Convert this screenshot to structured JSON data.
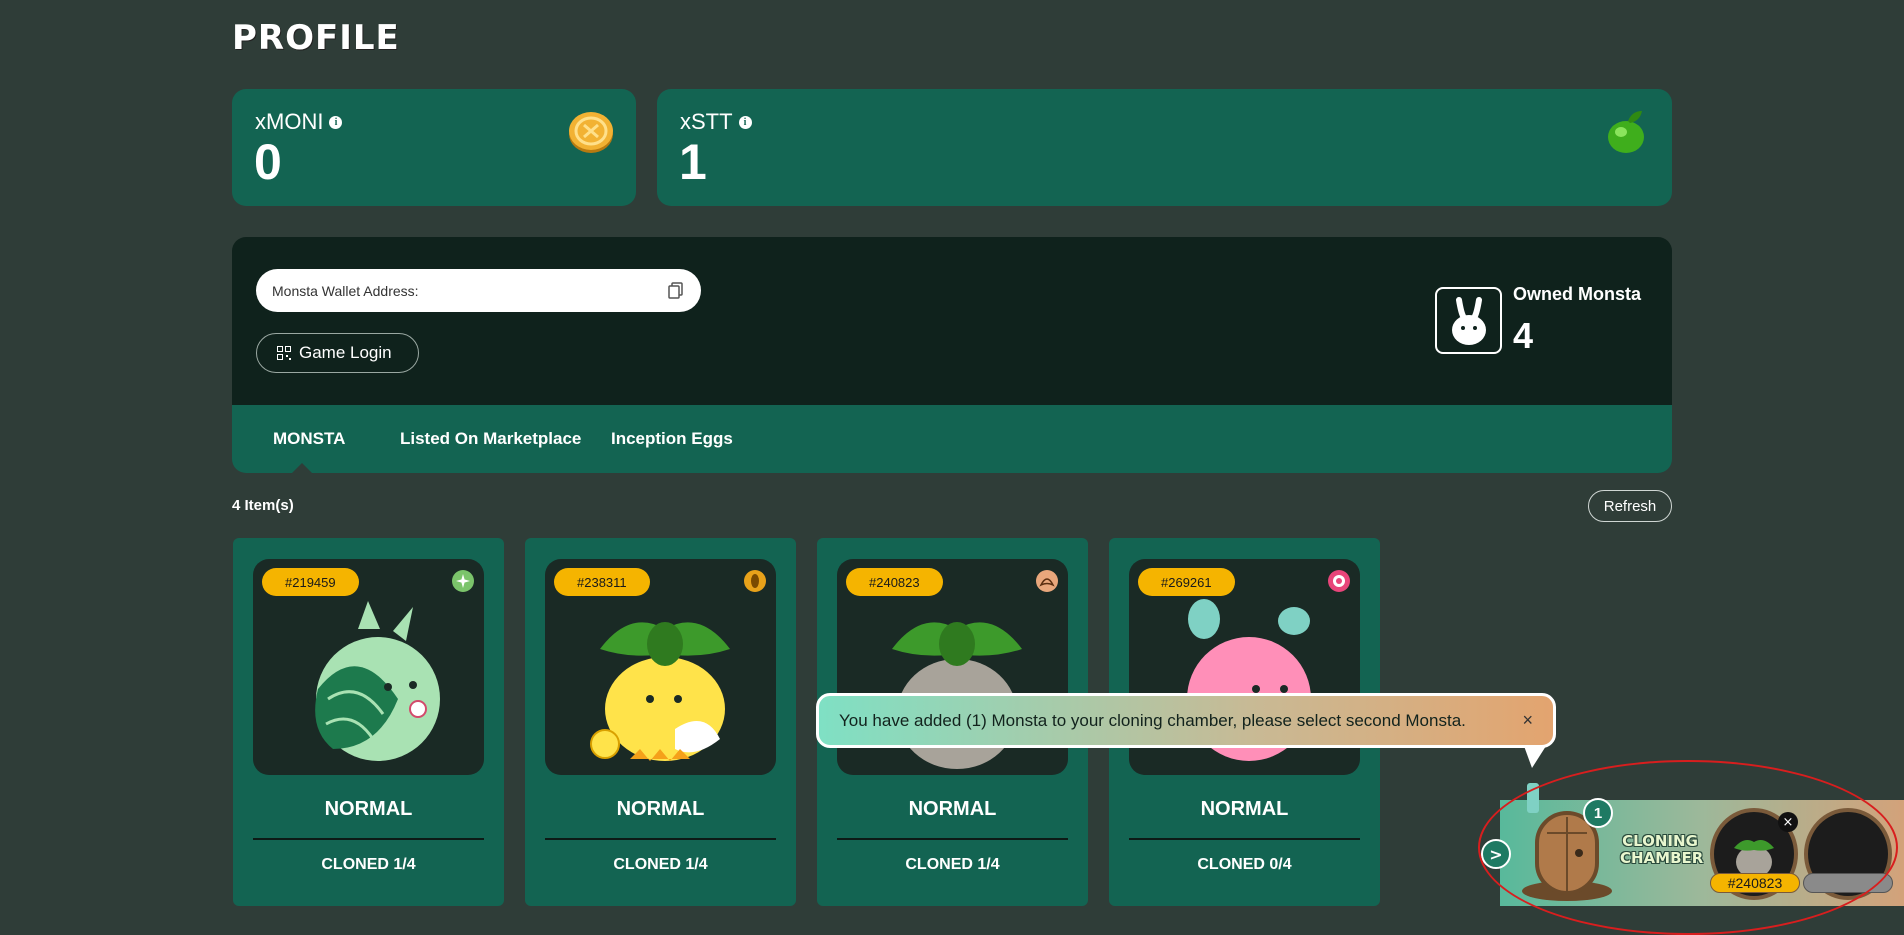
{
  "page": {
    "title": "PROFILE"
  },
  "balances": {
    "moni": {
      "label": "xMONI",
      "value": "0",
      "icon": "coin-icon"
    },
    "stt": {
      "label": "xSTT",
      "value": "1",
      "icon": "green-fruit-icon"
    }
  },
  "wallet": {
    "address_label": "Monsta Wallet Address:",
    "game_login_label": "Game Login",
    "owned_label": "Owned Monsta",
    "owned_count": "4"
  },
  "tabs": [
    {
      "label": "MONSTA",
      "active": true
    },
    {
      "label": "Listed On Marketplace",
      "active": false
    },
    {
      "label": "Inception Eggs",
      "active": false
    }
  ],
  "list": {
    "count_label": "4 Item(s)",
    "refresh_label": "Refresh"
  },
  "cards": [
    {
      "id": "#219459",
      "rarity": "NORMAL",
      "cloned": "CLONED 1/4",
      "class_color": "#7bc46b",
      "body_color": "#a9e2b3"
    },
    {
      "id": "#238311",
      "rarity": "NORMAL",
      "cloned": "CLONED 1/4",
      "class_color": "#e8a21a",
      "body_color": "#ffe34a"
    },
    {
      "id": "#240823",
      "rarity": "NORMAL",
      "cloned": "CLONED 1/4",
      "class_color": "#e9a77c",
      "body_color": "#a8a39a"
    },
    {
      "id": "#269261",
      "rarity": "NORMAL",
      "cloned": "CLONED 0/4",
      "class_color": "#e8457a",
      "body_color": "#ff8fb8"
    }
  ],
  "toast": {
    "message": "You have added (1) Monsta to your cloning chamber, please select second Monsta.",
    "close": "×"
  },
  "chamber": {
    "title_line1": "CLONING",
    "title_line2": "CHAMBER",
    "count": "1",
    "arrow": ">",
    "slot1_id": "#240823",
    "slot_close": "×"
  },
  "colors": {
    "background": "#2f3d38",
    "card": "#136452",
    "panel_dark": "#0f221c",
    "badge": "#f5b400"
  }
}
